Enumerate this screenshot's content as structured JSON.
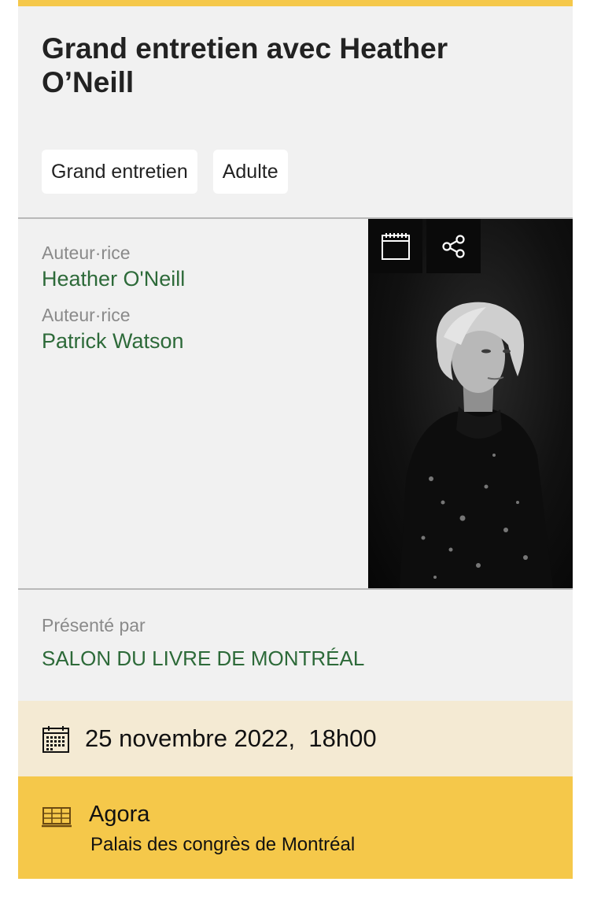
{
  "event": {
    "title": "Grand entretien avec Heather O’Neill",
    "tags": [
      "Grand entretien",
      "Adulte"
    ]
  },
  "contributors": [
    {
      "role": "Auteur·rice",
      "name": "Heather O'Neill"
    },
    {
      "role": "Auteur·rice",
      "name": "Patrick Watson"
    }
  ],
  "presented": {
    "label": "Présenté par",
    "organizer": "SALON DU LIVRE DE MONTRÉAL"
  },
  "schedule": {
    "date_time": "25 novembre 2022,  18h00"
  },
  "venue": {
    "name": "Agora",
    "place": "Palais des congrès de Montréal"
  },
  "icons": {
    "calendar_button": "calendar-icon",
    "share_button": "share-icon",
    "date": "calendar-icon",
    "venue": "building-icon"
  },
  "colors": {
    "accent_yellow": "#f5c84a",
    "date_band": "#f4ead3",
    "link_green": "#2d6a39",
    "card_bg": "#f1f1f1"
  }
}
